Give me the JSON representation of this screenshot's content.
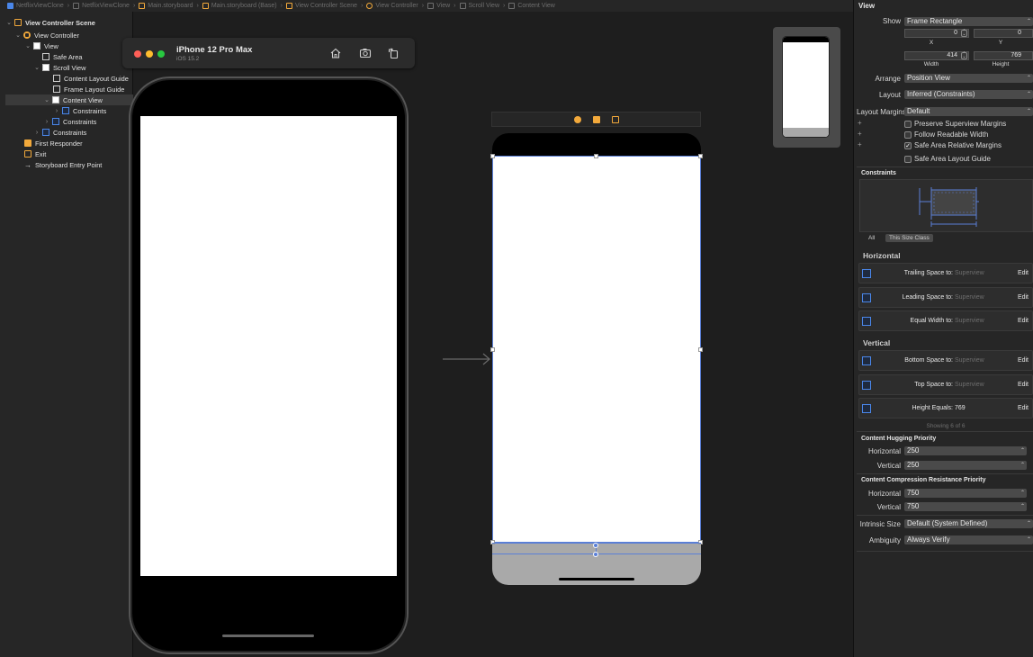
{
  "breadcrumb": {
    "items": [
      "NetflixViewClone",
      "NetflixViewClone",
      "Main.storyboard",
      "Main.storyboard (Base)",
      "View Controller Scene",
      "View Controller",
      "View",
      "Scroll View",
      "Content View"
    ]
  },
  "outline": {
    "scene": "View Controller Scene",
    "view_controller": "View Controller",
    "view": "View",
    "safe_area": "Safe Area",
    "scroll_view": "Scroll View",
    "content_layout_guide": "Content Layout Guide",
    "frame_layout_guide": "Frame Layout Guide",
    "content_view": "Content View",
    "constraints_content": "Constraints",
    "constraints_scroll": "Constraints",
    "constraints_view": "Constraints",
    "first_responder": "First Responder",
    "exit": "Exit",
    "entry_point": "Storyboard Entry Point"
  },
  "simulator": {
    "device": "iPhone 12 Pro Max",
    "os": "iOS 15.2",
    "home_icon": "house-icon",
    "screenshot_icon": "camera-icon",
    "rotate_icon": "rotate-icon"
  },
  "inspector": {
    "title": "View",
    "show_label": "Show",
    "show_value": "Frame Rectangle",
    "x_value": "0",
    "y_value": "0",
    "x_label": "X",
    "y_label": "Y",
    "width_value": "414",
    "height_value": "769",
    "width_label": "Width",
    "height_label": "Height",
    "arrange_label": "Arrange",
    "arrange_value": "Position View",
    "layout_label": "Layout",
    "layout_value": "Inferred (Constraints)",
    "layout_margins_label": "Layout Margins",
    "layout_margins_value": "Default",
    "preserve_margins": "Preserve Superview Margins",
    "follow_readable": "Follow Readable Width",
    "safe_area_relative": "Safe Area Relative Margins",
    "safe_area_guide": "Safe Area Layout Guide",
    "constraints_title": "Constraints",
    "tab_all": "All",
    "tab_size_class": "This Size Class",
    "horizontal_title": "Horizontal",
    "vertical_title": "Vertical",
    "superview": "Superview",
    "edit": "Edit",
    "horizontal_constraints": [
      {
        "label": "Trailing Space to:",
        "target": "Superview"
      },
      {
        "label": "Leading Space to:",
        "target": "Superview"
      },
      {
        "label": "Equal Width to:",
        "target": "Superview"
      }
    ],
    "vertical_constraints": [
      {
        "label": "Bottom Space to:",
        "target": "Superview"
      },
      {
        "label": "Top Space to:",
        "target": "Superview"
      },
      {
        "label": "Height Equals:",
        "target": "769"
      }
    ],
    "showing": "Showing 6 of 6",
    "hugging_title": "Content Hugging Priority",
    "hugging_h_label": "Horizontal",
    "hugging_h_value": "250",
    "hugging_v_label": "Vertical",
    "hugging_v_value": "250",
    "compression_title": "Content Compression Resistance Priority",
    "compression_h_label": "Horizontal",
    "compression_h_value": "750",
    "compression_v_label": "Vertical",
    "compression_v_value": "750",
    "intrinsic_label": "Intrinsic Size",
    "intrinsic_value": "Default (System Defined)",
    "ambiguity_label": "Ambiguity",
    "ambiguity_value": "Always Verify",
    "checks": {
      "preserve": false,
      "follow": false,
      "safe_relative": true,
      "safe_guide": false
    }
  },
  "colors": {
    "accent_blue": "#5a7fd6",
    "storyboard_orange": "#f2a93b",
    "traffic_red": "#ff5f57",
    "traffic_yellow": "#febc2e",
    "traffic_green": "#28c840"
  }
}
